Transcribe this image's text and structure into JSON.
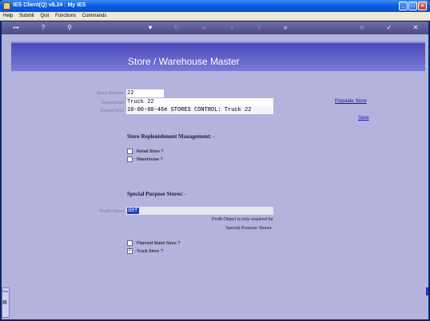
{
  "window": {
    "title": "IES Client(Q) v8.24 : My IES"
  },
  "menu": [
    "Help",
    "Submit",
    "Quit",
    "Functions",
    "Commands"
  ],
  "page": {
    "title": "Store / Warehouse Master"
  },
  "form": {
    "store_number": {
      "label": "Store Number",
      "value": "22"
    },
    "description": {
      "label": "Description",
      "value": "Truck 22"
    },
    "control_acct": {
      "label": "Control Acct",
      "value": "10-00-00-46e STORES CONTROL: Truck 22"
    },
    "profit_object": {
      "label": "Profit Object",
      "value": "def"
    }
  },
  "links": {
    "populate": "Populate Store",
    "save": "Save"
  },
  "sections": {
    "replenishment": "Store Replenishment Management: -",
    "special": "Special Purpose Stores: -"
  },
  "checkboxes": {
    "retail": {
      "label": ": Retail Store ?",
      "checked": false
    },
    "warehouse": {
      "label": ": Warehouse ?",
      "checked": false
    },
    "planned_maint": {
      "label": ": Planned Maint Store ?",
      "checked": false
    },
    "truck": {
      "label": ": Truck Store ?",
      "checked": true
    }
  },
  "notes": {
    "line1": "Profit Object is only required for",
    "line2": "Special Purpose Stores."
  },
  "sidebar": {
    "label": "Sea"
  }
}
